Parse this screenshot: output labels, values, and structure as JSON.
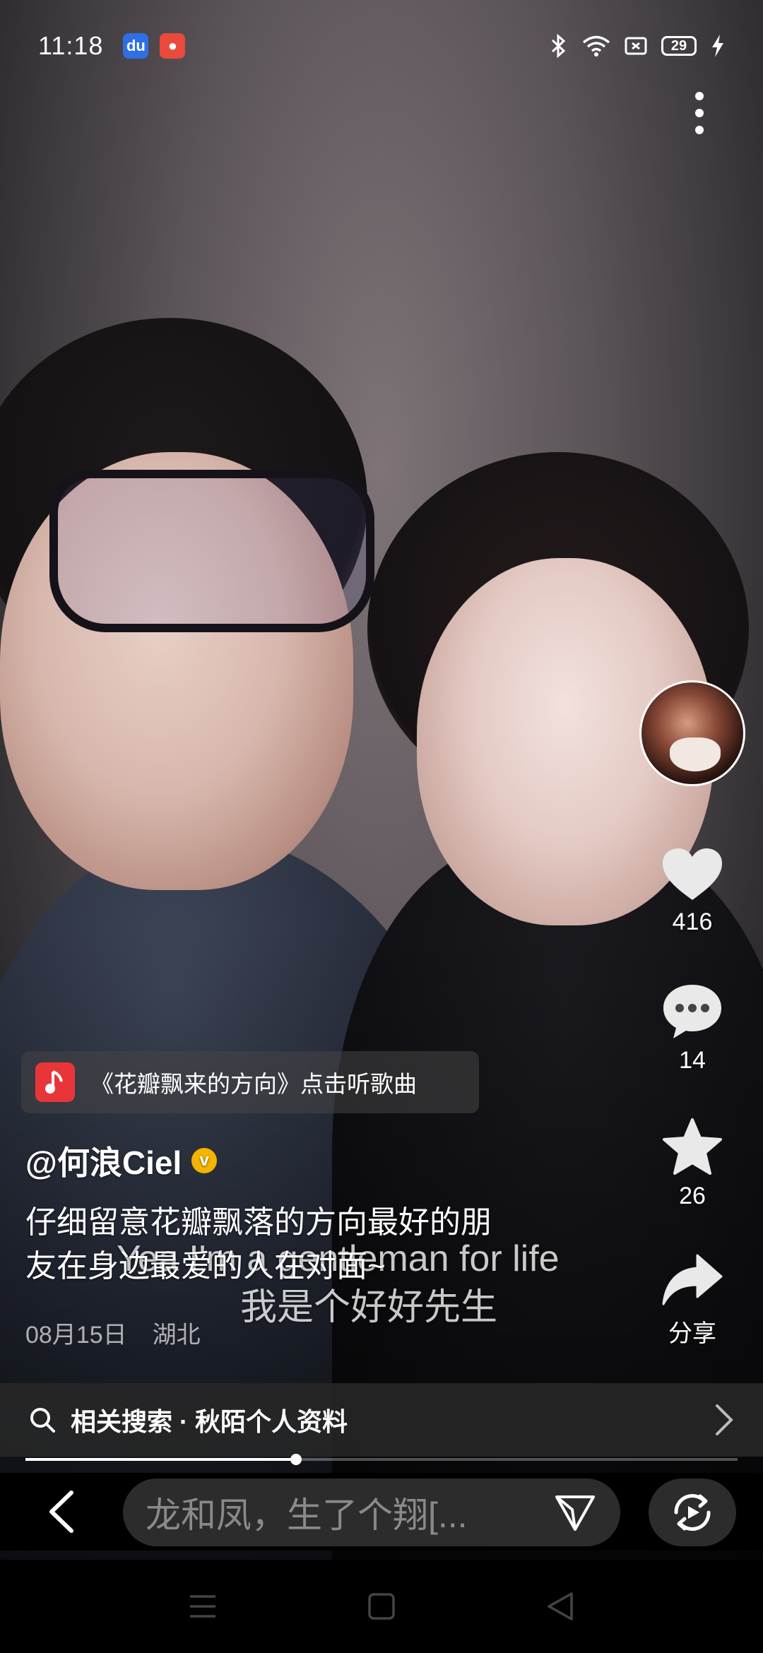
{
  "status_bar": {
    "time": "11:18",
    "battery": "29",
    "icons": [
      "baidu-icon",
      "app-notification-icon",
      "bluetooth-icon",
      "wifi-icon",
      "sim-icon",
      "battery-icon",
      "charging-icon"
    ]
  },
  "side_actions": {
    "likes": "416",
    "comments": "14",
    "favorites": "26",
    "share_label": "分享"
  },
  "music": {
    "label": "《花瓣飘来的方向》点击听歌曲"
  },
  "post": {
    "author": "@何浪Ciel",
    "caption_line1": "仔细留意花瓣飘落的方向最好的朋",
    "caption_line2": "友在身边最爱的人在对面~",
    "date": "08月15日",
    "location": "湖北"
  },
  "subtitles": {
    "english": "Yea I'm a gentleman for life",
    "chinese": "我是个好好先生"
  },
  "related_search": {
    "text": "相关搜索 · 秋陌个人资料"
  },
  "progress": {
    "fraction": 0.38
  },
  "comment_box": {
    "placeholder": "龙和凤，生了个翔[..."
  },
  "colors": {
    "accent_red": "#e8353a",
    "verified_gold": "#f4b400",
    "input_bg": "#2c2c2c"
  }
}
